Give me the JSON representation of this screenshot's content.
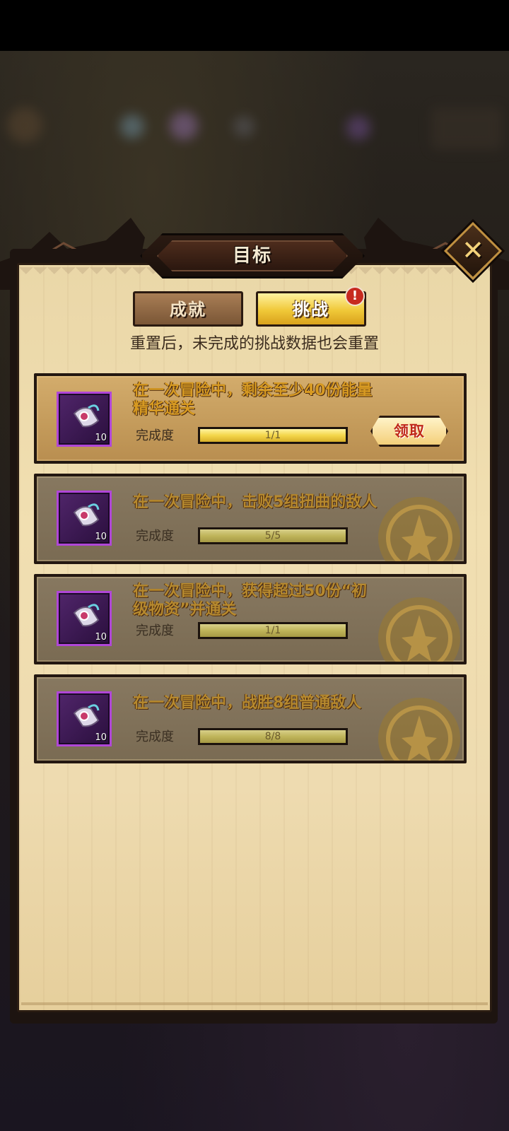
{
  "window": {
    "title": "目标"
  },
  "tabs": [
    {
      "label": "成就",
      "selected": false
    },
    {
      "label": "挑战",
      "selected": true,
      "badge": "!"
    }
  ],
  "notice": "重置后，未完成的挑战数据也会重置",
  "progress_label": "完成度",
  "challenges": [
    {
      "title_line1": "在一次冒险中，剩余至少40份能量",
      "title_line2": "精华通关",
      "item_count": "10",
      "progress_text": "1/1",
      "progress": 1.0,
      "claimed": false,
      "claim_label": "领取"
    },
    {
      "title_line1": "在一次冒险中，击败5组扭曲的敌人",
      "title_line2": "",
      "item_count": "10",
      "progress_text": "5/5",
      "progress": 1.0,
      "claimed": true
    },
    {
      "title_line1": "在一次冒险中，获得超过50份“初",
      "title_line2": "级物资”并通关",
      "item_count": "10",
      "progress_text": "1/1",
      "progress": 1.0,
      "claimed": true
    },
    {
      "title_line1": "在一次冒险中，战胜8组普通敌人",
      "title_line2": "",
      "item_count": "10",
      "progress_text": "8/8",
      "progress": 1.0,
      "claimed": true
    }
  ],
  "icons": {
    "close": "close-icon",
    "reward": "scroll-item-icon",
    "stamp": "completed-stamp-icon",
    "alert": "alert-badge-icon"
  },
  "colors": {
    "panel": "#efdcae",
    "accent_gold": "#f0c838",
    "title_text": "#d79a22",
    "claim_text": "#c0281a",
    "item_frame": "#b046d8"
  }
}
